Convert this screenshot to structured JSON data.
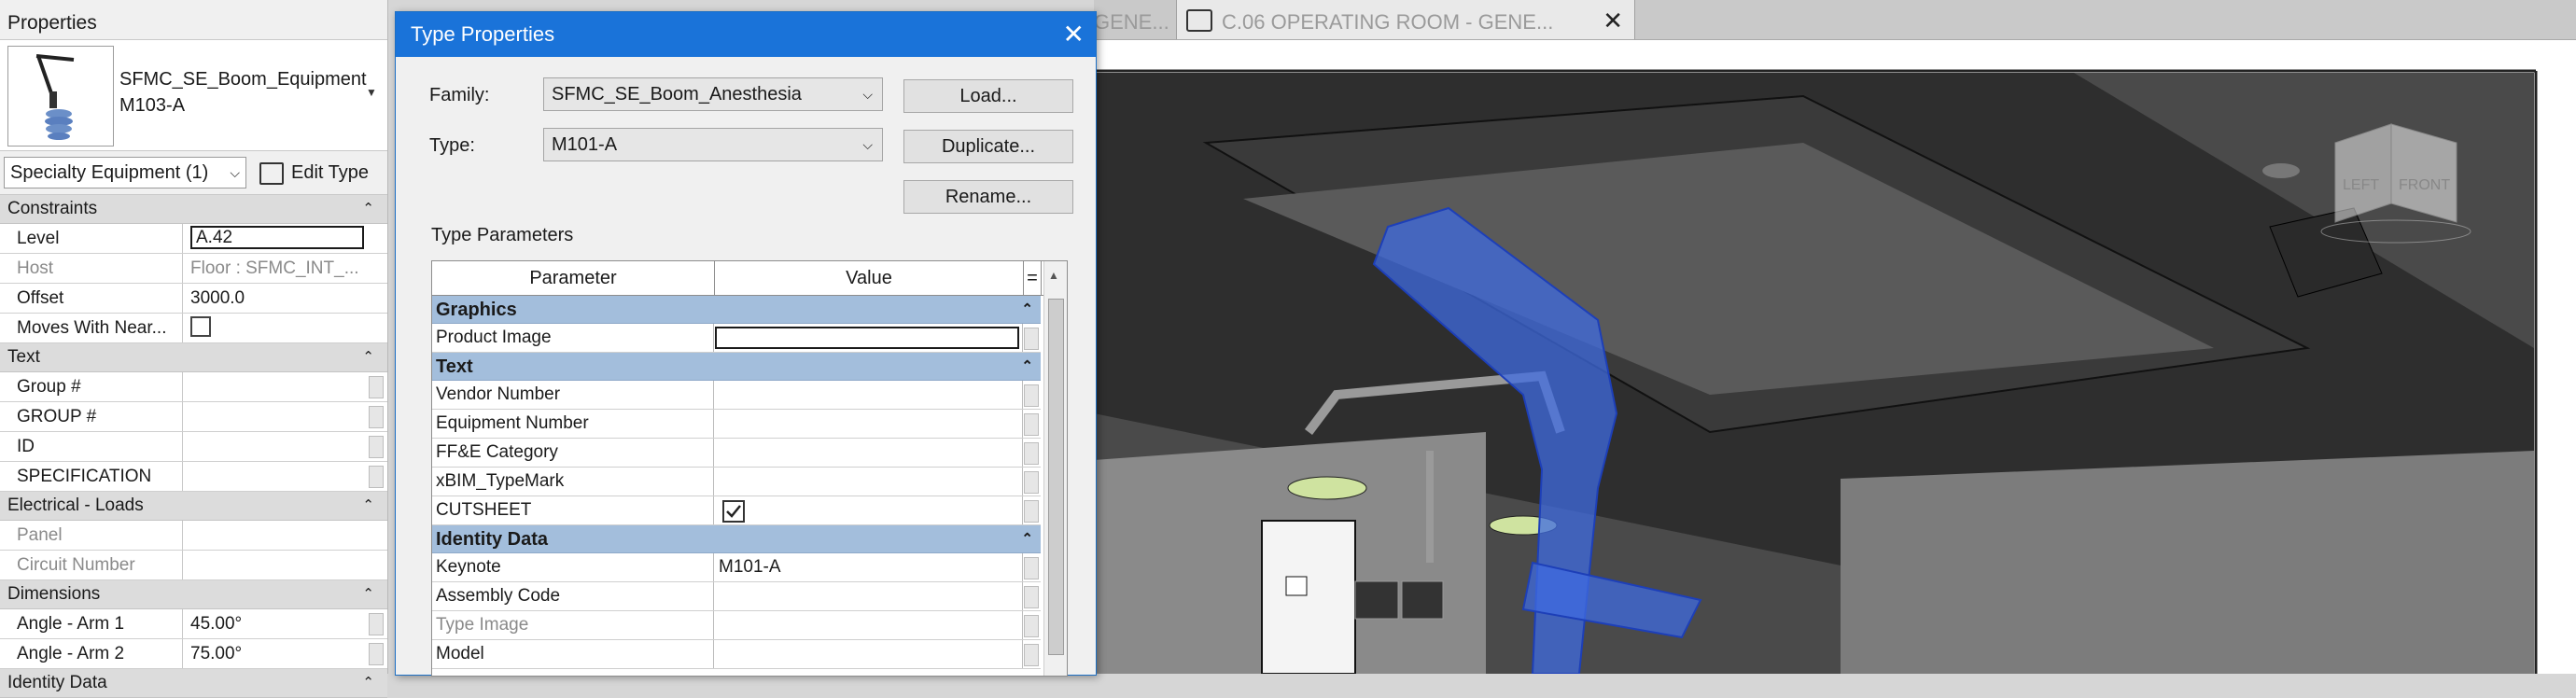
{
  "properties": {
    "title": "Properties",
    "type_name": "SFMC_SE_Boom_Equipment M103-A",
    "category": "Specialty Equipment (1)",
    "edit_type": "Edit Type",
    "sections": {
      "constraints": "Constraints",
      "text": "Text",
      "electrical": "Electrical - Loads",
      "dimensions": "Dimensions",
      "identity": "Identity Data"
    },
    "rows": {
      "level": {
        "k": "Level",
        "v": "A.42"
      },
      "host": {
        "k": "Host",
        "v": "Floor : SFMC_INT_..."
      },
      "offset": {
        "k": "Offset",
        "v": "3000.0"
      },
      "moves": {
        "k": "Moves With Near..."
      },
      "group_num": {
        "k": "Group #"
      },
      "group_num_caps": {
        "k": "GROUP #"
      },
      "id": {
        "k": "ID"
      },
      "specification": {
        "k": "SPECIFICATION"
      },
      "panel": {
        "k": "Panel"
      },
      "circuit": {
        "k": "Circuit Number"
      },
      "angle1": {
        "k": "Angle - Arm 1",
        "v": "45.00°"
      },
      "angle2": {
        "k": "Angle - Arm 2",
        "v": "75.00°"
      }
    }
  },
  "view": {
    "tab_prev": "GENE...",
    "tab_active": "C.06 OPERATING ROOM - GENE...",
    "viewcube_left": "LEFT",
    "viewcube_front": "FRONT"
  },
  "dialog": {
    "title": "Type Properties",
    "family_label": "Family:",
    "family_value": "SFMC_SE_Boom_Anesthesia",
    "type_label": "Type:",
    "type_value": "M101-A",
    "load": "Load...",
    "duplicate": "Duplicate...",
    "rename": "Rename...",
    "type_parameters": "Type Parameters",
    "col_parameter": "Parameter",
    "col_value": "Value",
    "col_eq": "=",
    "sections": {
      "graphics": "Graphics",
      "text": "Text",
      "identity": "Identity Data"
    },
    "rows": {
      "product_image": "Product Image",
      "vendor_number": "Vendor Number",
      "equipment_number": "Equipment Number",
      "ffe_category": "FF&E Category",
      "xbim_typemark": "xBIM_TypeMark",
      "cutsheet": "CUTSHEET",
      "keynote": "Keynote",
      "keynote_value": "M101-A",
      "assembly_code": "Assembly Code",
      "type_image": "Type Image",
      "model": "Model"
    }
  }
}
